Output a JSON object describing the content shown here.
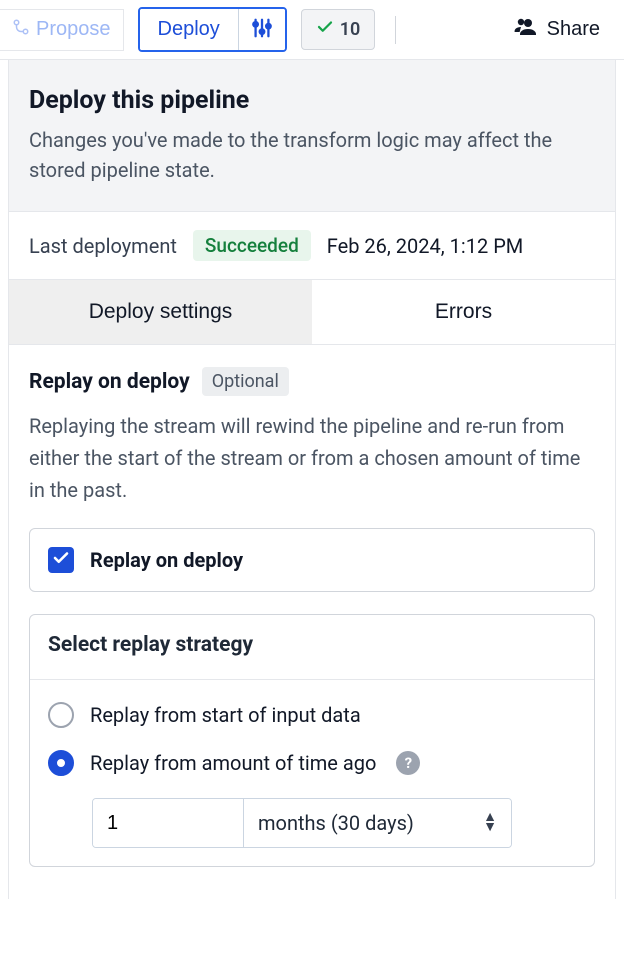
{
  "toolbar": {
    "propose": "Propose",
    "deploy": "Deploy",
    "status_count": "10",
    "share": "Share"
  },
  "panel": {
    "title": "Deploy this pipeline",
    "subtitle": "Changes you've made to the transform logic may affect the stored pipeline state."
  },
  "last_deploy": {
    "label": "Last deployment",
    "status": "Succeeded",
    "date": "Feb 26, 2024, 1:12 PM"
  },
  "tabs": {
    "settings": "Deploy settings",
    "errors": "Errors"
  },
  "replay": {
    "heading": "Replay on deploy",
    "optional": "Optional",
    "description": "Replaying the stream will rewind the pipeline and re-run from either the start of the stream or from a chosen amount of time in the past.",
    "checkbox_label": "Replay on deploy"
  },
  "strategy": {
    "heading": "Select replay strategy",
    "opt_start": "Replay from start of input data",
    "opt_time": "Replay from amount of time ago",
    "time_value": "1",
    "time_unit": "months (30 days)"
  }
}
